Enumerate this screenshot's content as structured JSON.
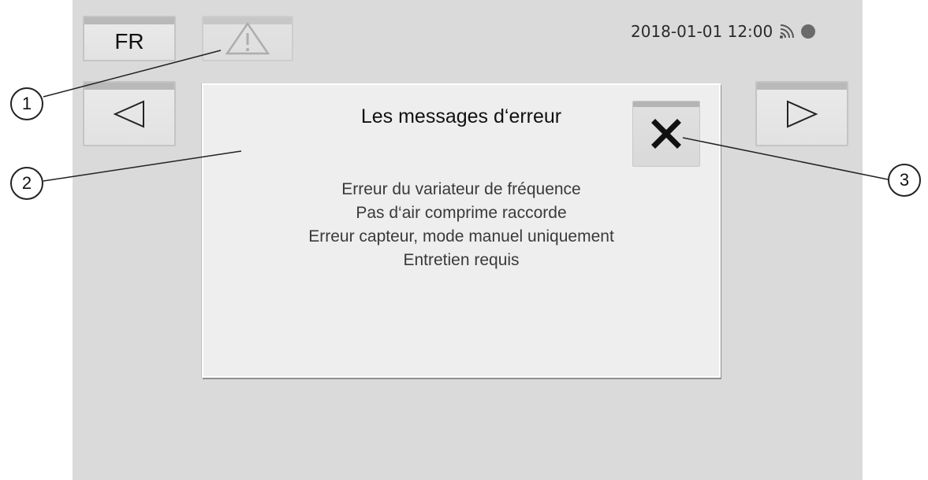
{
  "header": {
    "language_label": "FR",
    "datetime": "2018-01-01 12:00"
  },
  "icons": {
    "warning": "warning-triangle-icon",
    "prev": "triangle-left-icon",
    "next": "triangle-right-icon",
    "close": "close-x-icon",
    "signal": "wifi-signal-icon",
    "status": "status-dot-icon"
  },
  "dialog": {
    "title": "Les messages d‘erreur",
    "messages": [
      "Erreur du variateur de fréquence",
      "Pas d‘air comprime raccorde",
      "Erreur capteur, mode manuel uniquement",
      "Entretien requis"
    ]
  },
  "callouts": [
    "1",
    "2",
    "3"
  ],
  "colors": {
    "screen_bg": "#dadada",
    "dialog_bg": "#eeeeee",
    "status_dot": "#6a6a6a"
  }
}
